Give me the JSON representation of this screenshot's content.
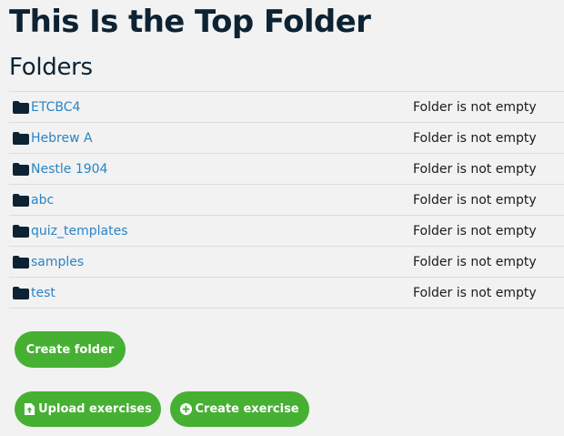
{
  "page": {
    "title": "This Is the Top Folder",
    "section_title": "Folders"
  },
  "folders": [
    {
      "name": "ETCBC4",
      "status": "Folder is not empty",
      "icon": "folder-icon"
    },
    {
      "name": "Hebrew A",
      "status": "Folder is not empty",
      "icon": "folder-icon"
    },
    {
      "name": "Nestle 1904",
      "status": "Folder is not empty",
      "icon": "folder-icon"
    },
    {
      "name": "abc",
      "status": "Folder is not empty",
      "icon": "folder-icon"
    },
    {
      "name": "quiz_templates",
      "status": "Folder is not empty",
      "icon": "folder-icon"
    },
    {
      "name": "samples",
      "status": "Folder is not empty",
      "icon": "folder-icon"
    },
    {
      "name": "test",
      "status": "Folder is not empty",
      "icon": "folder-icon"
    }
  ],
  "actions": {
    "create_folder_label": "Create folder",
    "upload_exercises_label": "Upload exercises",
    "upload_exercises_icon": "file-upload-icon",
    "create_exercise_label": "Create exercise",
    "create_exercise_icon": "plus-circle-icon"
  },
  "colors": {
    "background": "#f2f2f2",
    "title": "#0d2333",
    "link": "#2a84c4",
    "button": "#46b033",
    "row_border": "#dcdcdc"
  }
}
